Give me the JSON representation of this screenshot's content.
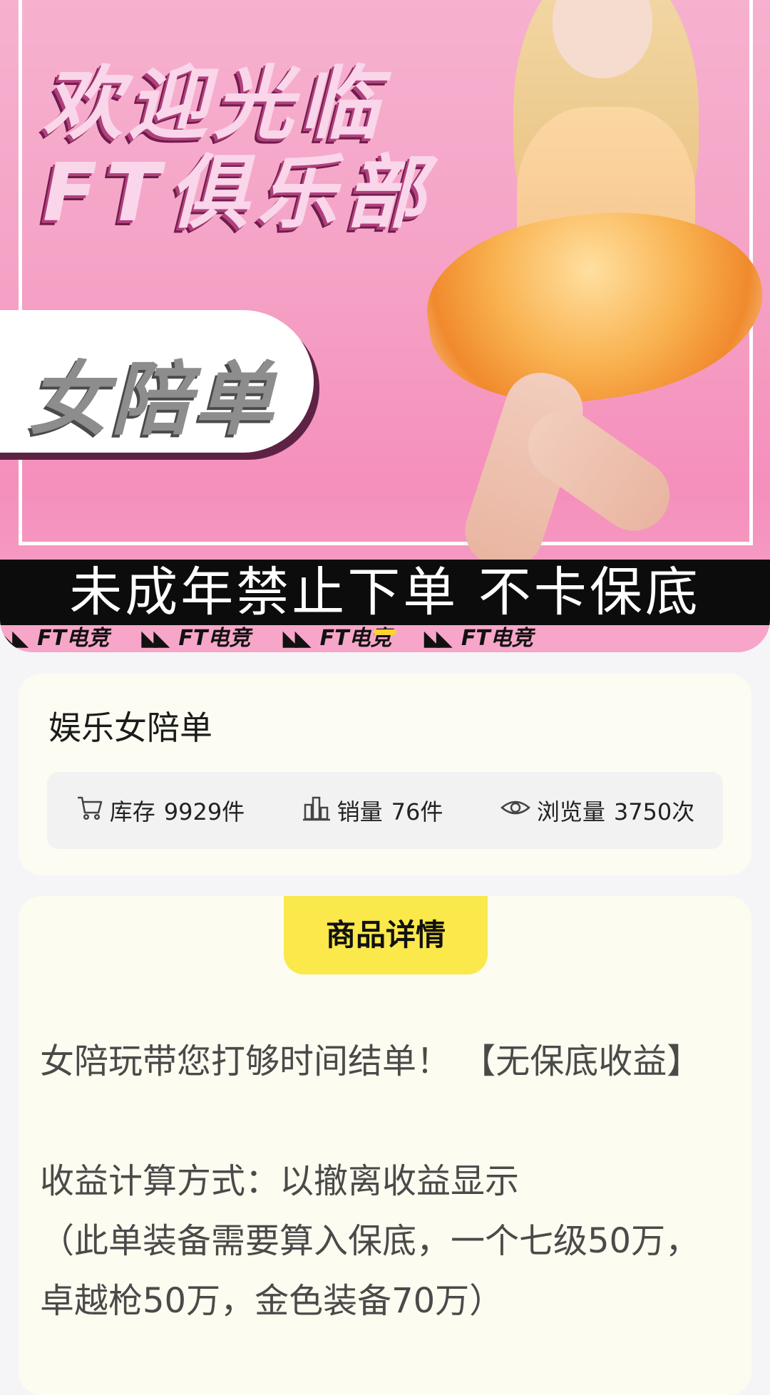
{
  "banner": {
    "headline_line1": "欢迎光临",
    "headline_line2": "FT俱乐部",
    "tag": "女陪单",
    "notice": "未成年禁止下单  不卡保底",
    "ticker": [
      "FT电竞",
      "FT电竞",
      "FT电竞",
      "FT电竞"
    ],
    "pink_color": "#f5a3c6"
  },
  "product": {
    "title": "娱乐女陪单",
    "stats": {
      "stock_label": "库存",
      "stock_value": "9929件",
      "sales_label": "销量",
      "sales_value": "76件",
      "views_label": "浏览量",
      "views_value": "3750次"
    }
  },
  "detail": {
    "tab_label": "商品详情",
    "tab_color": "#fbe84a",
    "line1": "女陪玩带您打够时间结单！ 【无保底收益】",
    "line2": "收益计算方式：以撤离收益显示",
    "line3": "（此单装备需要算入保底，一个七级50万，卓越枪50万，金色装备70万）"
  },
  "icons": [
    "cart-icon",
    "bar-chart-icon",
    "eye-icon"
  ]
}
